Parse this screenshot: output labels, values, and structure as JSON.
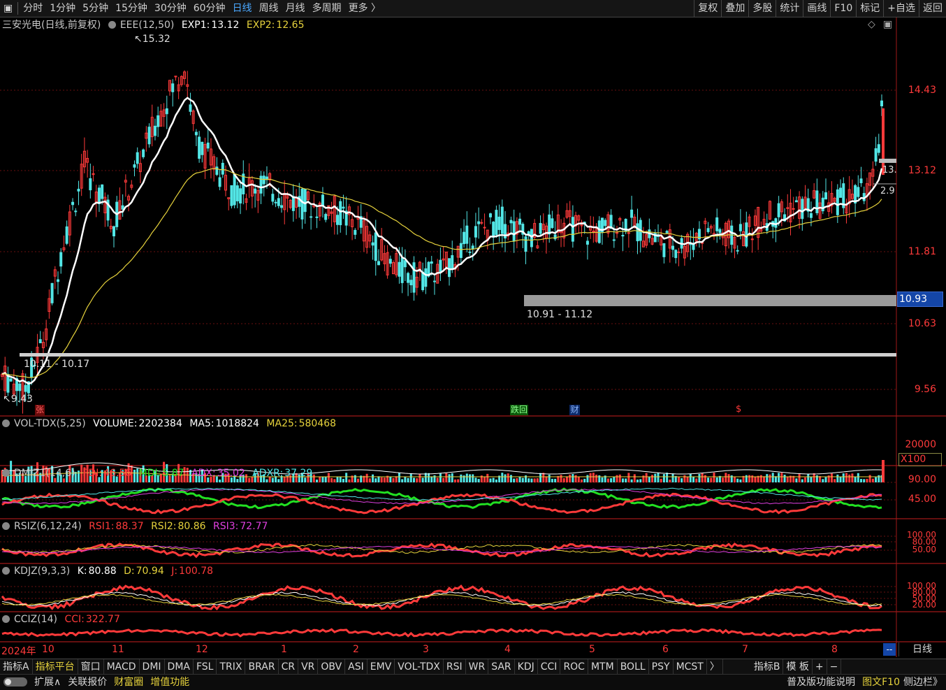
{
  "toolbar": {
    "periods": [
      "分时",
      "1分钟",
      "5分钟",
      "15分钟",
      "30分钟",
      "60分钟",
      "日线",
      "周线",
      "月线",
      "多周期",
      "更多 〉"
    ],
    "active_period": "日线",
    "right_buttons": [
      "复权",
      "叠加",
      "多股",
      "统计",
      "画线",
      "F10",
      "标记",
      "+自选",
      "返回"
    ]
  },
  "main_panel": {
    "stock_label": "三安光电(日线,前复权)",
    "indicator": "EEE(12,50)",
    "exp1_label": "EXP1:",
    "exp1_value": "13.12",
    "exp2_label": "EXP2:",
    "exp2_value": "12.65",
    "price_axis": [
      "14.43",
      "13.12",
      "11.81",
      "10.63",
      "9.56"
    ],
    "high_label": "15.32",
    "low_label": "9.43",
    "zone1_label": "10.91 - 11.12",
    "zone2_label": "10.11 - 10.17",
    "current_tag": "10.93",
    "right_price_tags": [
      "13.",
      "2.9"
    ],
    "event_marks": [
      "张",
      "跌回",
      "财",
      "$"
    ]
  },
  "vol_panel": {
    "name": "VOL-TDX(5,25)",
    "volume_label": "VOLUME:",
    "volume_value": "2202384",
    "ma5_label": "MA5:",
    "ma5_value": "1018824",
    "ma25_label": "MA25:",
    "ma25_value": "580468",
    "axis": [
      "20000"
    ],
    "unit": "X100"
  },
  "dmi_panel": {
    "name": "DMIZ1(14,6)",
    "pdi_label": "PDI:",
    "pdi_value": "46.56",
    "mdi_label": "MDI:",
    "mdi_value": "5.87",
    "adx_label": "ADX:",
    "adx_value": "35.02",
    "adxr_label": "ADXR:",
    "adxr_value": "37.29",
    "axis": [
      "90.00",
      "45.00"
    ]
  },
  "rsi_panel": {
    "name": "RSIZ(6,12,24)",
    "rsi1_label": "RSI1:",
    "rsi1_value": "88.37",
    "rsi2_label": "RSI2:",
    "rsi2_value": "80.86",
    "rsi3_label": "RSI3:",
    "rsi3_value": "72.77",
    "axis": [
      "100.00",
      "80.00",
      "50.00"
    ]
  },
  "kdj_panel": {
    "name": "KDJZ(9,3,3)",
    "k_label": "K:",
    "k_value": "80.88",
    "d_label": "D:",
    "d_value": "70.94",
    "j_label": "J:",
    "j_value": "100.78",
    "axis": [
      "100.00",
      "80.00",
      "50.00",
      "20.00"
    ]
  },
  "cci_panel": {
    "name": "CCIZ(14)",
    "cci_label": "CCI:",
    "cci_value": "322.77"
  },
  "time_axis": [
    "2024年",
    "10",
    "11",
    "12",
    "1",
    "2",
    "3",
    "4",
    "5",
    "6",
    "7",
    "8"
  ],
  "corner": {
    "period_label": "日线",
    "dash": "--"
  },
  "indicator_tabs": [
    "指标A",
    "指标平台",
    "窗口",
    "MACD",
    "DMI",
    "DMA",
    "FSL",
    "TRIX",
    "BRAR",
    "CR",
    "VR",
    "OBV",
    "ASI",
    "EMV",
    "VOL-TDX",
    "RSI",
    "WR",
    "SAR",
    "KDJ",
    "CCI",
    "ROC",
    "MTM",
    "BOLL",
    "PSY",
    "MCST",
    "〉",
    "指标B",
    "模 板",
    "+",
    "−"
  ],
  "status": {
    "expand": "扩展∧",
    "related": "关联报价",
    "wealth": "财富圈",
    "value_added": "增值功能",
    "help": "普及版功能说明",
    "f10": "图文F10",
    "sidebar": "侧边栏》"
  },
  "colors": {
    "up": "#ff3a3a",
    "down": "#52e6e6",
    "ma_white": "#ffffff",
    "ma_yellow": "#e6d23c",
    "magenta": "#e040e0",
    "green": "#22e022",
    "grid": "#6a1010",
    "zone": "#9a9a9a"
  },
  "chart_data": {
    "type": "candlestick",
    "price_ylim": [
      9.2,
      15.5
    ],
    "series": [
      {
        "name": "EXP1",
        "last": 13.12
      },
      {
        "name": "EXP2",
        "last": 12.65
      }
    ]
  }
}
